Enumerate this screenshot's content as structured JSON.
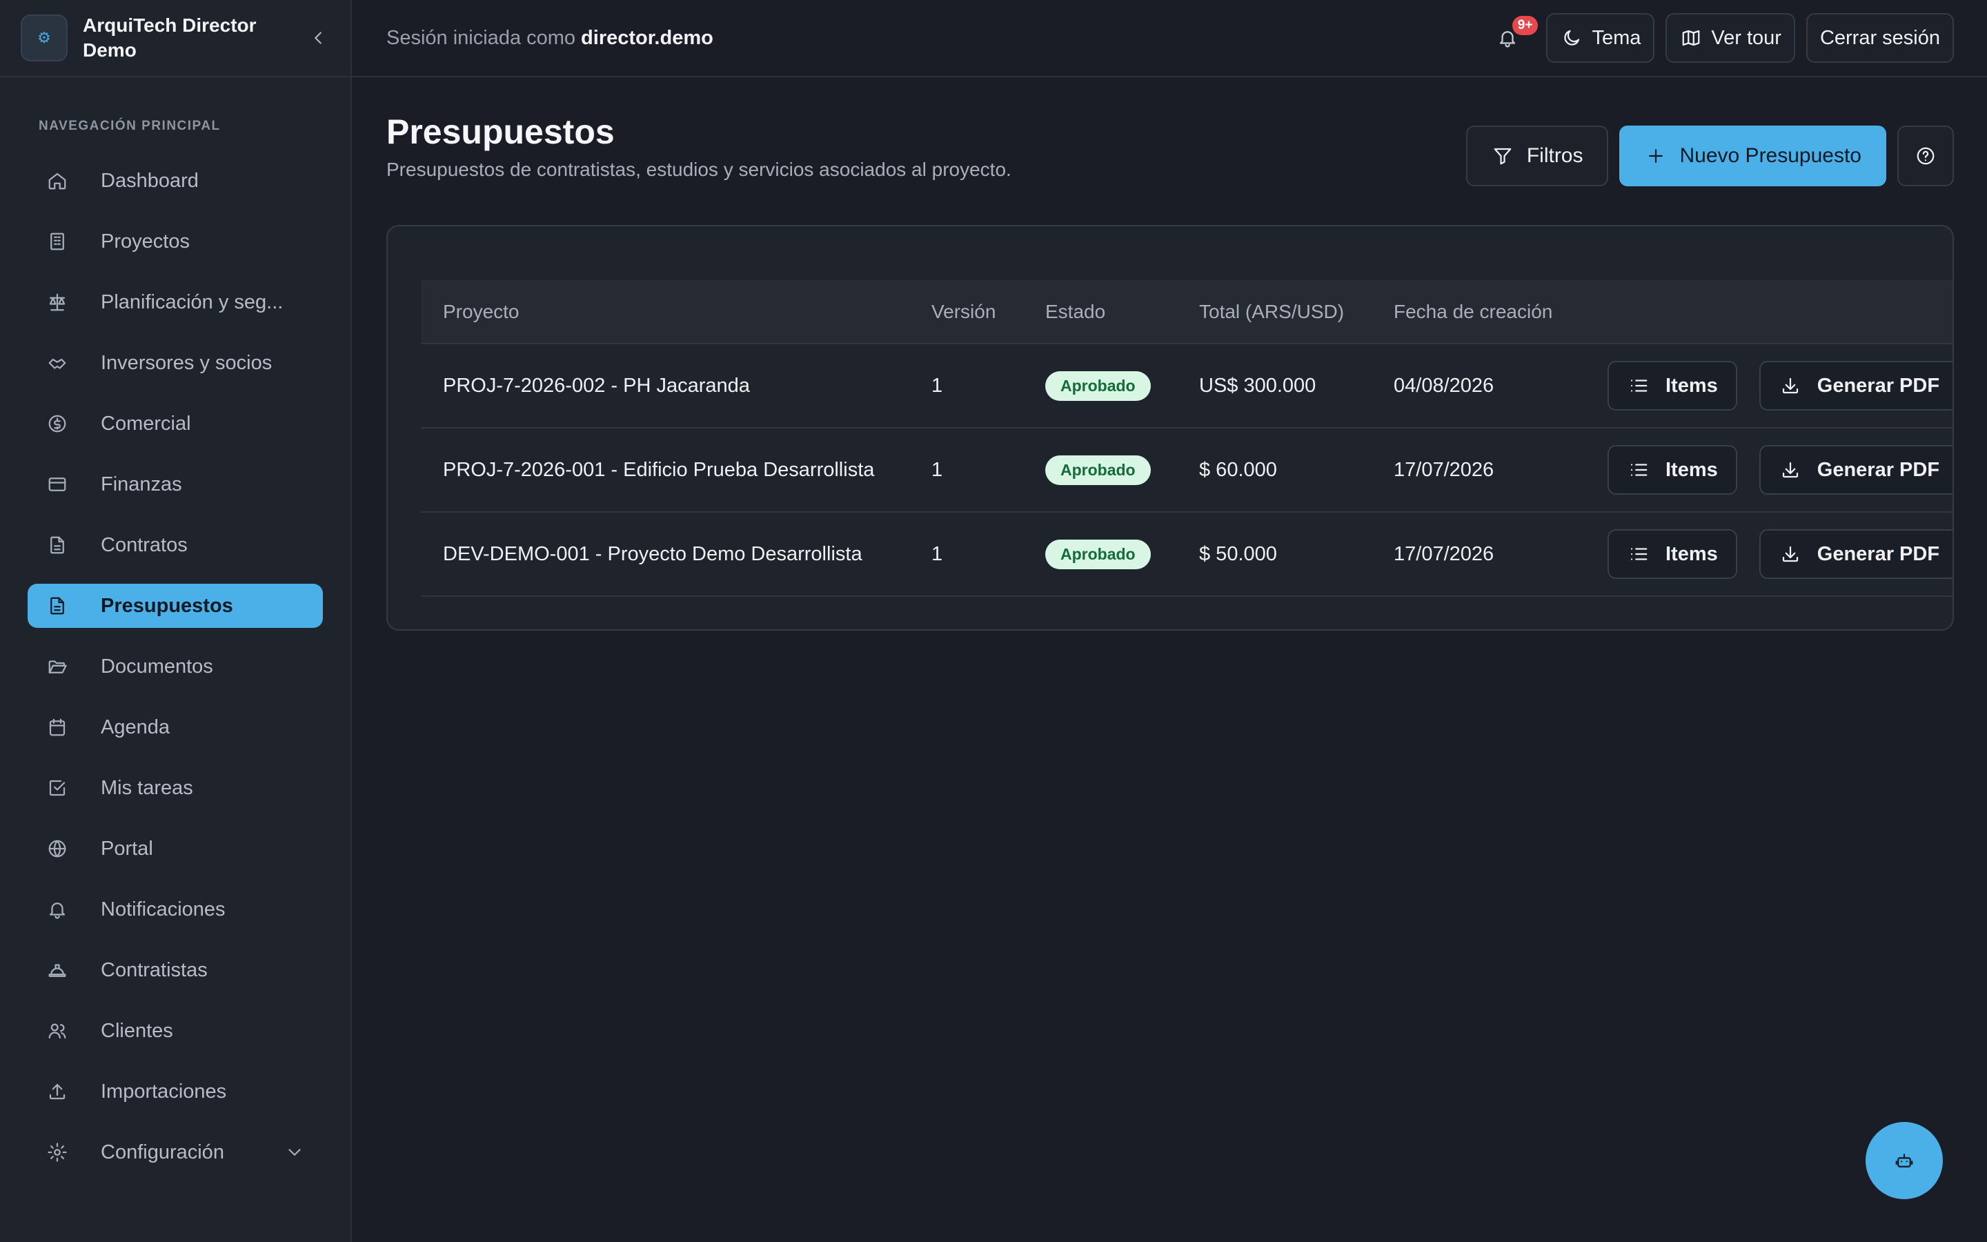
{
  "brand": {
    "name": "ArquiTech Director Demo"
  },
  "session": {
    "prefix": "Sesión iniciada como",
    "user": "director.demo"
  },
  "topbar": {
    "notifications_badge": "9+",
    "theme_label": "Tema",
    "tour_label": "Ver tour",
    "logout_label": "Cerrar sesión"
  },
  "sidebar": {
    "section_label": "NAVEGACIÓN PRINCIPAL",
    "items": [
      {
        "label": "Dashboard",
        "icon": "home-icon"
      },
      {
        "label": "Proyectos",
        "icon": "building-icon"
      },
      {
        "label": "Planificación y seg...",
        "icon": "scale-icon"
      },
      {
        "label": "Inversores y socios",
        "icon": "handshake-icon"
      },
      {
        "label": "Comercial",
        "icon": "dollar-circle-icon"
      },
      {
        "label": "Finanzas",
        "icon": "credit-card-icon"
      },
      {
        "label": "Contratos",
        "icon": "file-text-icon"
      },
      {
        "label": "Presupuestos",
        "icon": "file-text-icon",
        "active": true
      },
      {
        "label": "Documentos",
        "icon": "folder-open-icon"
      },
      {
        "label": "Agenda",
        "icon": "calendar-icon"
      },
      {
        "label": "Mis tareas",
        "icon": "checkbox-icon"
      },
      {
        "label": "Portal",
        "icon": "globe-icon"
      },
      {
        "label": "Notificaciones",
        "icon": "bell-icon"
      },
      {
        "label": "Contratistas",
        "icon": "hard-hat-icon"
      },
      {
        "label": "Clientes",
        "icon": "users-icon"
      },
      {
        "label": "Importaciones",
        "icon": "upload-icon"
      },
      {
        "label": "Configuración",
        "icon": "gear-icon"
      }
    ]
  },
  "page": {
    "title": "Presupuestos",
    "subtitle": "Presupuestos de contratistas, estudios y servicios asociados al proyecto.",
    "filters_label": "Filtros",
    "new_label": "Nuevo Presupuesto"
  },
  "table": {
    "columns": [
      "Proyecto",
      "Versión",
      "Estado",
      "Total (ARS/USD)",
      "Fecha de creación"
    ],
    "items_label": "Items",
    "pdf_label": "Generar PDF",
    "rows": [
      {
        "proyecto": "PROJ-7-2026-002 - PH Jacaranda",
        "version": "1",
        "estado": "Aprobado",
        "total": "US$ 300.000",
        "fecha": "04/08/2026"
      },
      {
        "proyecto": "PROJ-7-2026-001 - Edificio Prueba Desarrollista",
        "version": "1",
        "estado": "Aprobado",
        "total": "$ 60.000",
        "fecha": "17/07/2026"
      },
      {
        "proyecto": "DEV-DEMO-001 - Proyecto Demo Desarrollista",
        "version": "1",
        "estado": "Aprobado",
        "total": "$ 50.000",
        "fecha": "17/07/2026"
      }
    ]
  },
  "colors": {
    "accent": "#4cb0e8",
    "background": "#1a1d25",
    "sidebar": "#1f232c",
    "success_bg": "#d9f5e3",
    "success_text": "#146c3a"
  }
}
